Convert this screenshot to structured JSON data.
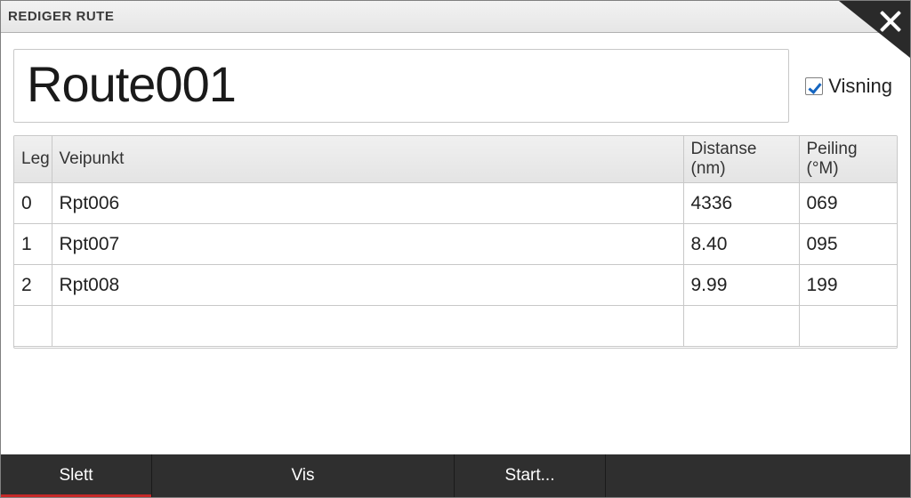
{
  "header": {
    "title": "REDIGER RUTE"
  },
  "route": {
    "name": "Route001"
  },
  "visning": {
    "label": "Visning",
    "checked": true
  },
  "columns": {
    "leg": "Leg",
    "waypoint": "Veipunkt",
    "distance": "Distanse (nm)",
    "bearing": "Peiling (°M)"
  },
  "rows": [
    {
      "leg": "0",
      "waypoint": "Rpt006",
      "distance": "4336",
      "bearing": "069"
    },
    {
      "leg": "1",
      "waypoint": "Rpt007",
      "distance": "8.40",
      "bearing": "095"
    },
    {
      "leg": "2",
      "waypoint": "Rpt008",
      "distance": "9.99",
      "bearing": "199"
    }
  ],
  "footer": {
    "delete": "Slett",
    "show": "Vis",
    "start": "Start..."
  }
}
